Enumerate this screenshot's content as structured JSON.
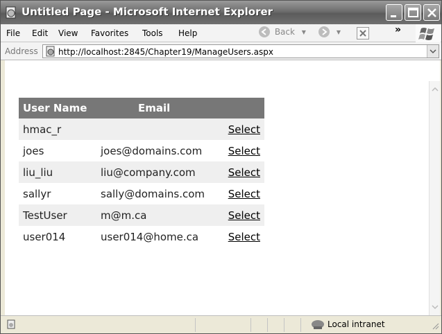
{
  "window": {
    "title": "Untitled Page - Microsoft Internet Explorer"
  },
  "menu": {
    "items": [
      "File",
      "Edit",
      "View",
      "Favorites",
      "Tools",
      "Help"
    ],
    "back_label": "Back",
    "more_label": "»"
  },
  "address": {
    "label": "Address",
    "url": "http://localhost:2845/Chapter19/ManageUsers.aspx"
  },
  "grid": {
    "headers": {
      "user": "User Name",
      "email": "Email"
    },
    "rows": [
      {
        "user": "hmac_r",
        "email": "",
        "select": "Select"
      },
      {
        "user": "joes",
        "email": "joes@domains.com",
        "select": "Select"
      },
      {
        "user": "liu_liu",
        "email": "liu@company.com",
        "select": "Select"
      },
      {
        "user": "sallyr",
        "email": "sally@domains.com",
        "select": "Select"
      },
      {
        "user": "TestUser",
        "email": "m@m.ca",
        "select": "Select"
      },
      {
        "user": "user014",
        "email": "user014@home.ca",
        "select": "Select"
      }
    ]
  },
  "status": {
    "zone": "Local intranet"
  },
  "icons": {
    "app": "ie-page-icon",
    "minimize": "minimize-icon",
    "maximize": "maximize-icon",
    "close": "close-icon",
    "back": "back-arrow-icon",
    "forward": "forward-arrow-icon",
    "stop": "stop-icon",
    "windows_logo": "windows-logo-icon",
    "page": "page-icon",
    "intranet": "intranet-icon"
  }
}
